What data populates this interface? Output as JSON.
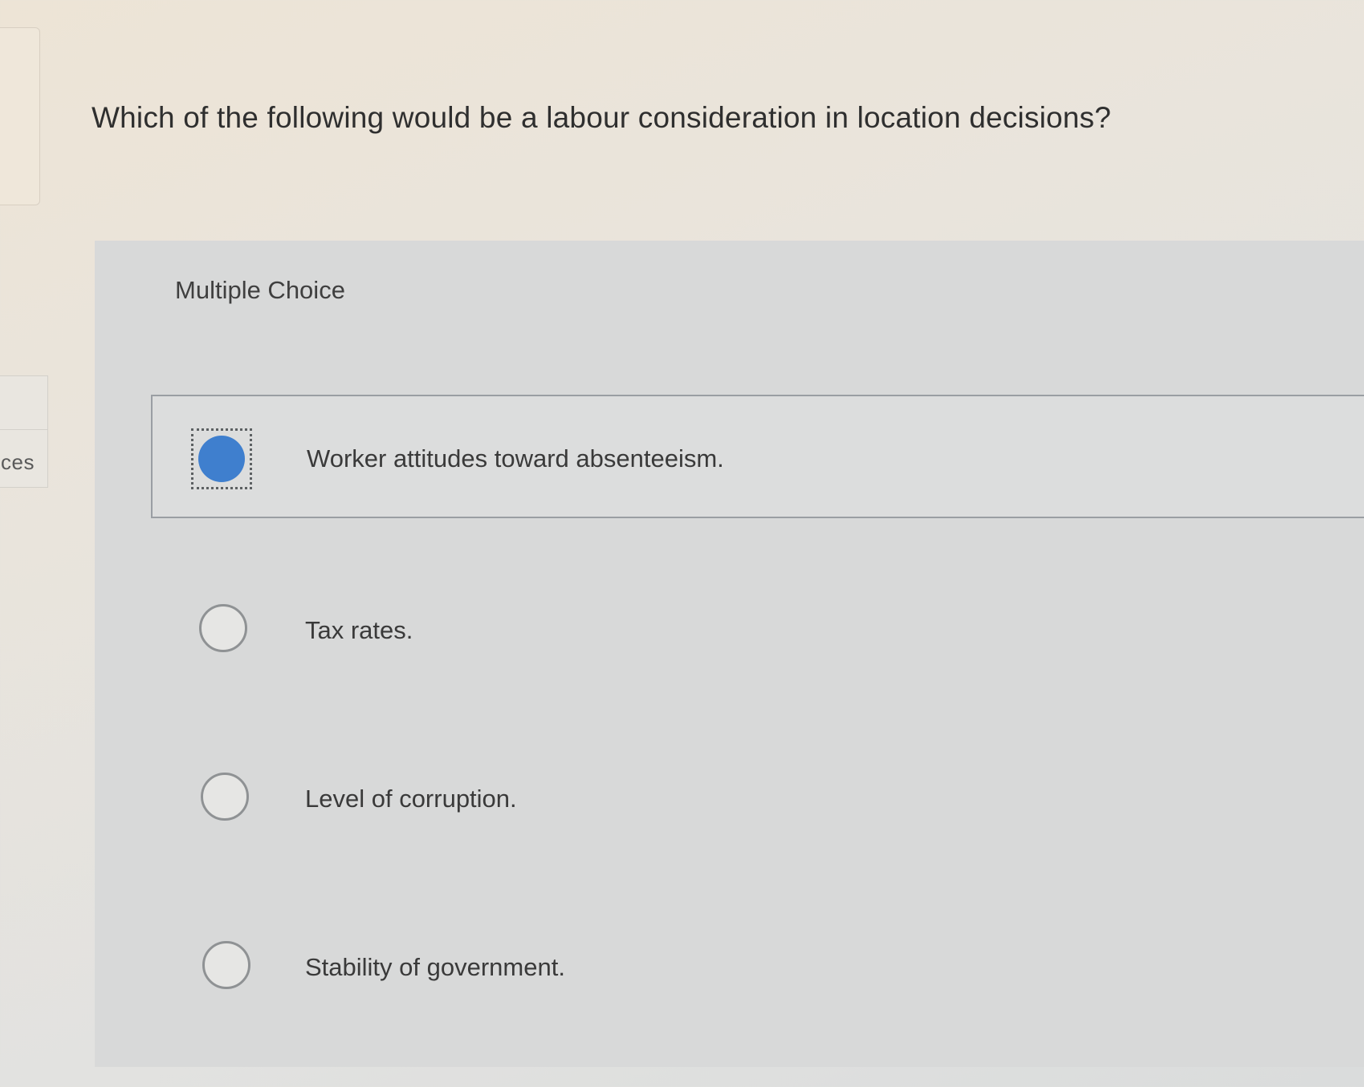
{
  "sidebar": {
    "tab_label": "ces"
  },
  "question": {
    "text": "Which of the following would be a labour consideration in location decisions?"
  },
  "multiple_choice": {
    "label": "Multiple Choice",
    "options": [
      {
        "text": "Worker attitudes toward absenteeism.",
        "selected": true
      },
      {
        "text": "Tax rates.",
        "selected": false
      },
      {
        "text": "Level of corruption.",
        "selected": false
      },
      {
        "text": "Stability of government.",
        "selected": false
      }
    ]
  },
  "colors": {
    "selected_radio": "#3f7fce",
    "panel_background": "#d8d9d9",
    "page_background": "#e9e4dc"
  }
}
